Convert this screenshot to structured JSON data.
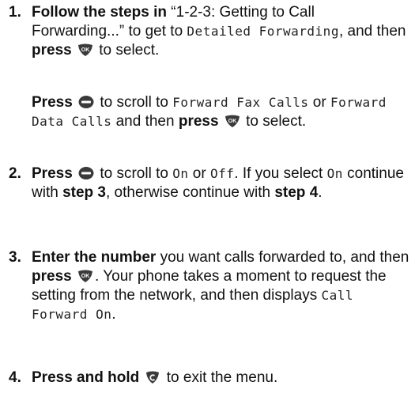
{
  "steps": [
    {
      "number": "1.",
      "parts": [
        {
          "b": "Follow the steps in"
        },
        {
          "t": " “1-2-3: Getting to Call Forwarding...” to get to "
        },
        {
          "m": "Detailed Forwarding"
        },
        {
          "t": ", and then "
        },
        {
          "b": "press"
        },
        {
          "t": " "
        },
        {
          "i": "ok-key-icon"
        },
        {
          "t": " to select."
        }
      ],
      "sub_parts": [
        {
          "b": "Press"
        },
        {
          "t": " "
        },
        {
          "i": "menu-key-icon"
        },
        {
          "t": " to scroll to "
        },
        {
          "m": "Forward Fax Calls"
        },
        {
          "t": " or "
        },
        {
          "m": "Forward Data Calls"
        },
        {
          "t": " and then "
        },
        {
          "b": "press"
        },
        {
          "t": " "
        },
        {
          "i": "ok-key-icon"
        },
        {
          "t": " to select."
        }
      ]
    },
    {
      "number": "2.",
      "parts": [
        {
          "b": "Press"
        },
        {
          "t": " "
        },
        {
          "i": "menu-key-icon"
        },
        {
          "t": " to scroll to "
        },
        {
          "m": "On"
        },
        {
          "t": " or "
        },
        {
          "m": "Off"
        },
        {
          "t": ". If you select "
        },
        {
          "m": "On"
        },
        {
          "t": " continue with "
        },
        {
          "b": "step 3"
        },
        {
          "t": ", otherwise continue with "
        },
        {
          "b": "step 4"
        },
        {
          "t": "."
        }
      ]
    },
    {
      "number": "3.",
      "parts": [
        {
          "b": "Enter the number"
        },
        {
          "t": " you want calls forwarded to, and then "
        },
        {
          "b": "press"
        },
        {
          "t": " "
        },
        {
          "i": "ok-key-icon"
        },
        {
          "t": ". Your phone takes a moment to request the setting from the network, and then displays "
        },
        {
          "m": "Call Forward On"
        },
        {
          "t": "."
        }
      ]
    },
    {
      "number": "4.",
      "parts": [
        {
          "b": "Press and hold"
        },
        {
          "t": " "
        },
        {
          "i": "clear-key-icon"
        },
        {
          "t": " to exit the menu."
        }
      ]
    }
  ],
  "icon_colors": {
    "key_fill": "#3a3a3a",
    "key_text": "#ffffff"
  }
}
